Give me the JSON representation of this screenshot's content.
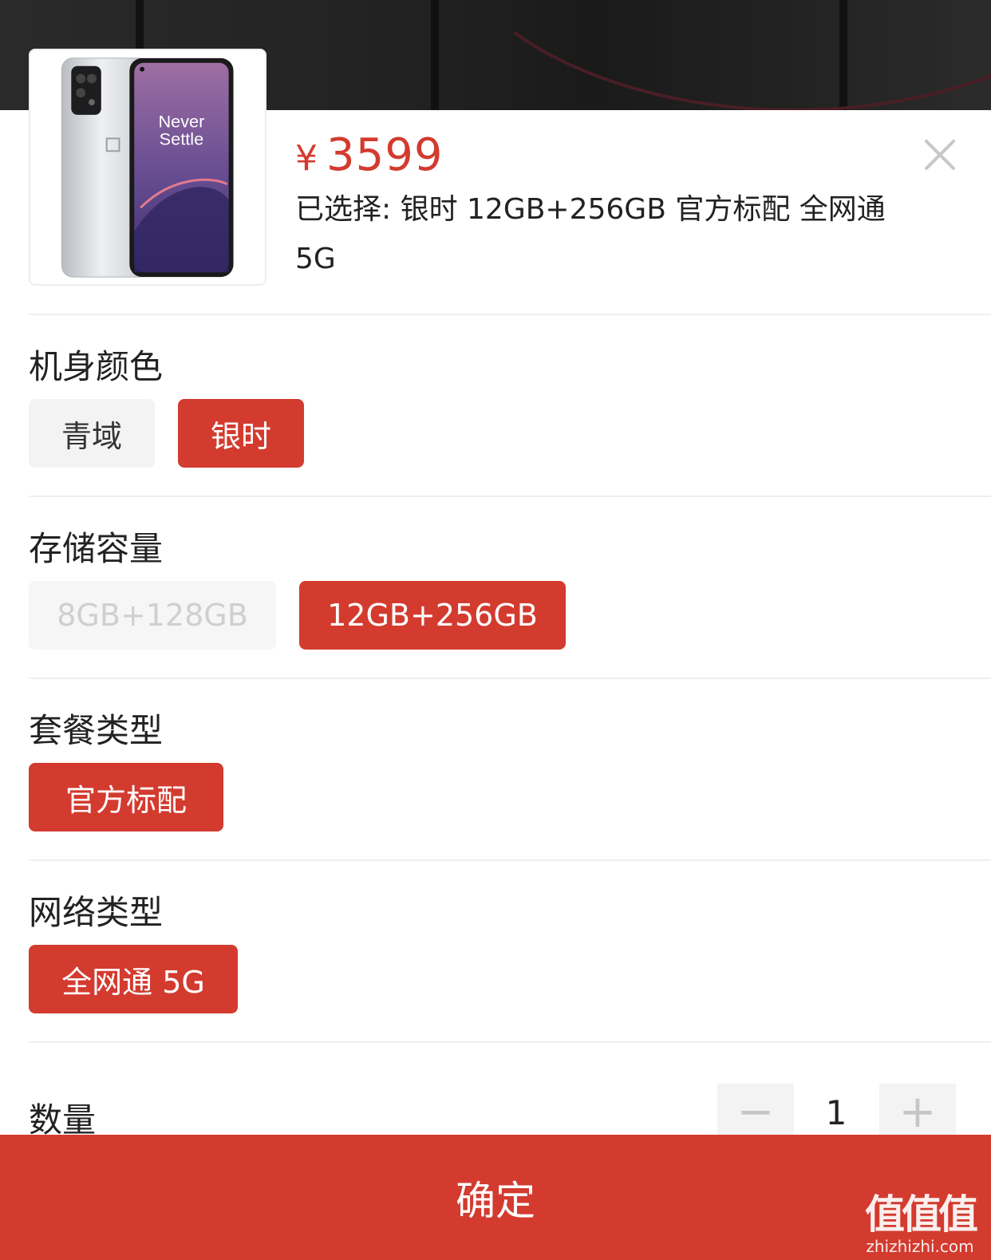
{
  "product": {
    "currency_symbol": "¥",
    "price": "3599",
    "selected_text": "已选择: 银时 12GB+256GB 官方标配 全网通 5G",
    "image_slogan_line1": "Never",
    "image_slogan_line2": "Settle"
  },
  "sections": {
    "color": {
      "title": "机身颜色",
      "options": [
        {
          "label": "青域",
          "state": "normal"
        },
        {
          "label": "银时",
          "state": "active"
        }
      ]
    },
    "storage": {
      "title": "存储容量",
      "options": [
        {
          "label": "8GB+128GB",
          "state": "disabled"
        },
        {
          "label": "12GB+256GB",
          "state": "active"
        }
      ]
    },
    "bundle": {
      "title": "套餐类型",
      "options": [
        {
          "label": "官方标配",
          "state": "active"
        }
      ]
    },
    "network": {
      "title": "网络类型",
      "options": [
        {
          "label": "全网通 5G",
          "state": "active"
        }
      ]
    }
  },
  "quantity": {
    "label": "数量",
    "value": "1",
    "minus": "−",
    "plus": "+"
  },
  "confirm_label": "确定",
  "watermark": {
    "big": "值值值",
    "small": "zhizhizhi.com"
  },
  "colors": {
    "accent": "#d33b2f",
    "disabled_text": "#cfcfcf",
    "option_bg": "#f3f3f3"
  }
}
